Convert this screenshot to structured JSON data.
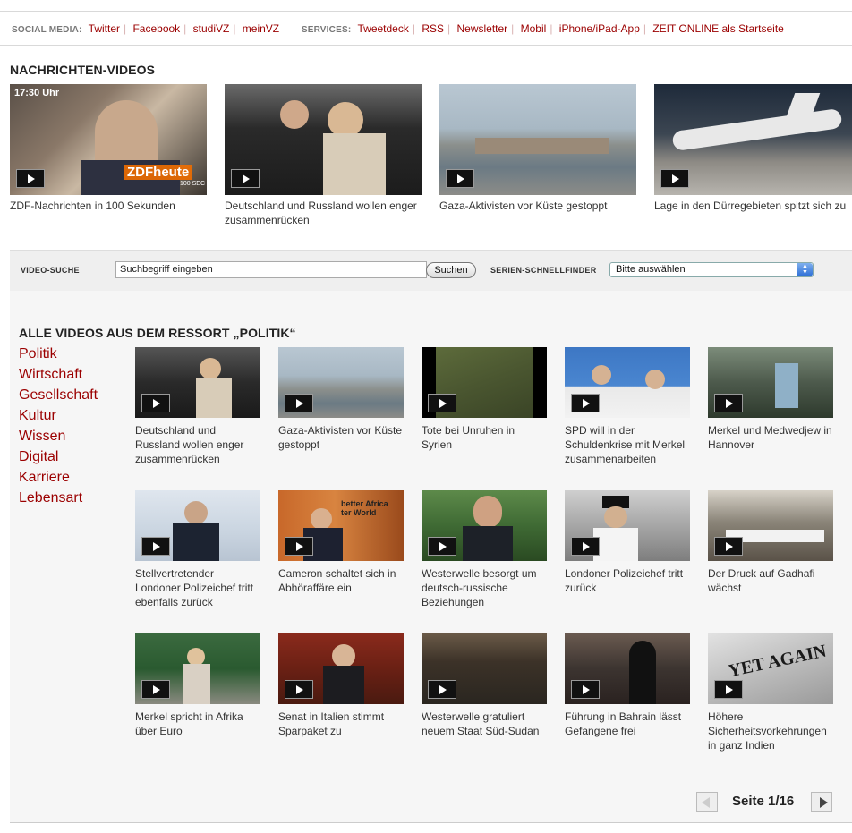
{
  "social": {
    "label": "SOCIAL MEDIA:",
    "links": [
      "Twitter",
      "Facebook",
      "studiVZ",
      "meinVZ"
    ],
    "services_label": "SERVICES:",
    "services": [
      "Tweetdeck",
      "RSS",
      "Newsletter",
      "Mobil",
      "iPhone/iPad-App",
      "ZEIT ONLINE als Startseite"
    ]
  },
  "news": {
    "title": "NACHRICHTEN-VIDEOS",
    "overlay_time": "17:30 Uhr",
    "overlay_logo": "ZDFheute",
    "overlay_sub": "100 SEC",
    "videos": [
      {
        "caption": "ZDF-Nachrichten in 100 Sekunden"
      },
      {
        "caption": "Deutschland und Russland wollen enger zusammenrücken"
      },
      {
        "caption": "Gaza-Aktivisten vor Küste gestoppt"
      },
      {
        "caption": "Lage in den Dürregebieten spitzt sich zu"
      }
    ]
  },
  "search": {
    "label": "VIDEO-SUCHE",
    "placeholder": "Suchbegriff eingeben",
    "button": "Suchen",
    "series_label": "SERIEN-SCHNELLFINDER",
    "select_value": "Bitte auswählen"
  },
  "ressort": {
    "title": "ALLE VIDEOS AUS DEM RESSORT „POLITIK“",
    "nav": [
      "Politik",
      "Wirtschaft",
      "Gesellschaft",
      "Kultur",
      "Wissen",
      "Digital",
      "Karriere",
      "Lebensart"
    ],
    "rows": [
      [
        {
          "caption": "Deutschland und Russland wollen enger zusammenrücken"
        },
        {
          "caption": "Gaza-Aktivisten vor Küste gestoppt"
        },
        {
          "caption": "Tote bei Unruhen in Syrien"
        },
        {
          "caption": "SPD will in der Schuldenkrise mit Merkel zusammenarbeiten"
        },
        {
          "caption": "Merkel und Medwedjew in Hannover"
        }
      ],
      [
        {
          "caption": "Stellvertretender Londoner Polizeichef tritt ebenfalls zurück"
        },
        {
          "caption": "Cameron schaltet sich in Abhöraffäre ein",
          "overlay": "better Africa\nter World"
        },
        {
          "caption": "Westerwelle besorgt um deutsch-russische Beziehungen"
        },
        {
          "caption": "Londoner Polizeichef tritt zurück"
        },
        {
          "caption": "Der Druck auf Gadhafi wächst"
        }
      ],
      [
        {
          "caption": "Merkel spricht in Afrika über Euro"
        },
        {
          "caption": "Senat in Italien stimmt Sparpaket zu"
        },
        {
          "caption": "Westerwelle gratuliert neuem Staat Süd-Sudan"
        },
        {
          "caption": "Führung in Bahrain lässt Gefangene frei"
        },
        {
          "caption": "Höhere Sicherheitsvorkehrungen in ganz Indien",
          "overlay": "YET AGAIN"
        }
      ]
    ],
    "pager": "Seite 1/16"
  }
}
